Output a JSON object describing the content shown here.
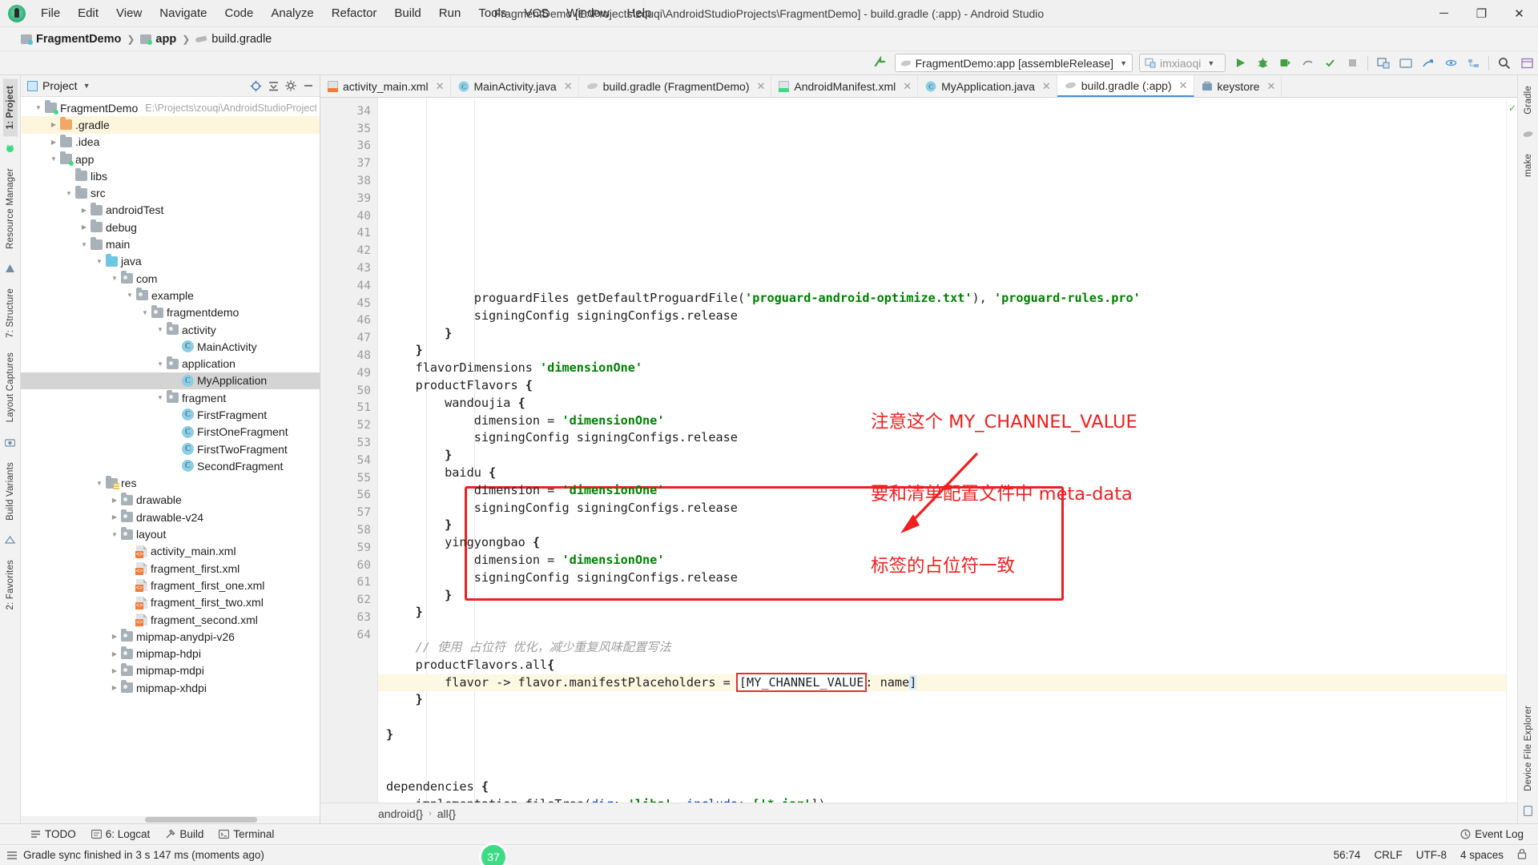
{
  "window": {
    "title": "FragmentDemo [E:\\Projects\\zouqi\\AndroidStudioProjects\\FragmentDemo] - build.gradle (:app) - Android Studio",
    "minimize": "─",
    "maximize": "❐",
    "close": "✕"
  },
  "menu": [
    {
      "label": "File"
    },
    {
      "label": "Edit"
    },
    {
      "label": "View"
    },
    {
      "label": "Navigate"
    },
    {
      "label": "Code"
    },
    {
      "label": "Analyze"
    },
    {
      "label": "Refactor"
    },
    {
      "label": "Build"
    },
    {
      "label": "Run"
    },
    {
      "label": "Tools"
    },
    {
      "label": "VCS"
    },
    {
      "label": "Window"
    },
    {
      "label": "Help"
    }
  ],
  "breadcrumb": {
    "project": "FragmentDemo",
    "module": "app",
    "file": "build.gradle"
  },
  "toolbar": {
    "run_config": "FragmentDemo:app [assembleRelease]",
    "device": "imxiaoqi",
    "search_icon": "search-icon",
    "caret": "▼"
  },
  "left_strip": [
    {
      "label": "1: Project"
    },
    {
      "label": "Resource Manager"
    },
    {
      "label": "7: Structure"
    },
    {
      "label": "Layout Captures"
    },
    {
      "label": "Build Variants"
    },
    {
      "label": "2: Favorites"
    }
  ],
  "right_strip": [
    {
      "label": "Gradle"
    },
    {
      "label": "make"
    },
    {
      "label": "Device File Explorer"
    },
    {
      "label": "Event Log"
    }
  ],
  "project_panel": {
    "title": "Project",
    "caret": "▼",
    "tree": [
      {
        "depth": 0,
        "arrow": "down",
        "icon": "folder-module",
        "label": "FragmentDemo",
        "path": "E:\\Projects\\zouqi\\AndroidStudioProject",
        "state": "normal"
      },
      {
        "depth": 1,
        "arrow": "right",
        "icon": "folder-orange",
        "label": ".gradle",
        "path": "",
        "state": "highlight"
      },
      {
        "depth": 1,
        "arrow": "right",
        "icon": "folder",
        "label": ".idea",
        "path": "",
        "state": "normal"
      },
      {
        "depth": 1,
        "arrow": "down",
        "icon": "folder-greendot",
        "label": "app",
        "path": "",
        "state": "normal"
      },
      {
        "depth": 2,
        "arrow": "none",
        "icon": "folder",
        "label": "libs",
        "path": "",
        "state": "normal"
      },
      {
        "depth": 2,
        "arrow": "down",
        "icon": "folder",
        "label": "src",
        "path": "",
        "state": "normal"
      },
      {
        "depth": 3,
        "arrow": "right",
        "icon": "folder",
        "label": "androidTest",
        "path": "",
        "state": "normal"
      },
      {
        "depth": 3,
        "arrow": "right",
        "icon": "folder",
        "label": "debug",
        "path": "",
        "state": "normal"
      },
      {
        "depth": 3,
        "arrow": "down",
        "icon": "folder",
        "label": "main",
        "path": "",
        "state": "normal"
      },
      {
        "depth": 4,
        "arrow": "down",
        "icon": "folder-cyan",
        "label": "java",
        "path": "",
        "state": "normal"
      },
      {
        "depth": 5,
        "arrow": "down",
        "icon": "folder-package",
        "label": "com",
        "path": "",
        "state": "normal"
      },
      {
        "depth": 6,
        "arrow": "down",
        "icon": "folder-package",
        "label": "example",
        "path": "",
        "state": "normal"
      },
      {
        "depth": 7,
        "arrow": "down",
        "icon": "folder-package",
        "label": "fragmentdemo",
        "path": "",
        "state": "normal"
      },
      {
        "depth": 8,
        "arrow": "down",
        "icon": "folder-package",
        "label": "activity",
        "path": "",
        "state": "normal"
      },
      {
        "depth": 9,
        "arrow": "none",
        "icon": "class",
        "label": "MainActivity",
        "path": "",
        "state": "normal"
      },
      {
        "depth": 8,
        "arrow": "down",
        "icon": "folder-package",
        "label": "application",
        "path": "",
        "state": "normal"
      },
      {
        "depth": 9,
        "arrow": "none",
        "icon": "class",
        "label": "MyApplication",
        "path": "",
        "state": "selected"
      },
      {
        "depth": 8,
        "arrow": "down",
        "icon": "folder-package",
        "label": "fragment",
        "path": "",
        "state": "normal"
      },
      {
        "depth": 9,
        "arrow": "none",
        "icon": "class",
        "label": "FirstFragment",
        "path": "",
        "state": "normal"
      },
      {
        "depth": 9,
        "arrow": "none",
        "icon": "class",
        "label": "FirstOneFragment",
        "path": "",
        "state": "normal"
      },
      {
        "depth": 9,
        "arrow": "none",
        "icon": "class",
        "label": "FirstTwoFragment",
        "path": "",
        "state": "normal"
      },
      {
        "depth": 9,
        "arrow": "none",
        "icon": "class",
        "label": "SecondFragment",
        "path": "",
        "state": "normal"
      },
      {
        "depth": 4,
        "arrow": "down",
        "icon": "folder-res",
        "label": "res",
        "path": "",
        "state": "normal"
      },
      {
        "depth": 5,
        "arrow": "right",
        "icon": "folder-package",
        "label": "drawable",
        "path": "",
        "state": "normal"
      },
      {
        "depth": 5,
        "arrow": "right",
        "icon": "folder-package",
        "label": "drawable-v24",
        "path": "",
        "state": "normal"
      },
      {
        "depth": 5,
        "arrow": "down",
        "icon": "folder-package",
        "label": "layout",
        "path": "",
        "state": "normal"
      },
      {
        "depth": 6,
        "arrow": "none",
        "icon": "xml",
        "label": "activity_main.xml",
        "path": "",
        "state": "normal"
      },
      {
        "depth": 6,
        "arrow": "none",
        "icon": "xml",
        "label": "fragment_first.xml",
        "path": "",
        "state": "normal"
      },
      {
        "depth": 6,
        "arrow": "none",
        "icon": "xml",
        "label": "fragment_first_one.xml",
        "path": "",
        "state": "normal"
      },
      {
        "depth": 6,
        "arrow": "none",
        "icon": "xml",
        "label": "fragment_first_two.xml",
        "path": "",
        "state": "normal"
      },
      {
        "depth": 6,
        "arrow": "none",
        "icon": "xml",
        "label": "fragment_second.xml",
        "path": "",
        "state": "normal"
      },
      {
        "depth": 5,
        "arrow": "right",
        "icon": "folder-package",
        "label": "mipmap-anydpi-v26",
        "path": "",
        "state": "normal"
      },
      {
        "depth": 5,
        "arrow": "right",
        "icon": "folder-package",
        "label": "mipmap-hdpi",
        "path": "",
        "state": "normal"
      },
      {
        "depth": 5,
        "arrow": "right",
        "icon": "folder-package",
        "label": "mipmap-mdpi",
        "path": "",
        "state": "normal"
      },
      {
        "depth": 5,
        "arrow": "right",
        "icon": "folder-package",
        "label": "mipmap-xhdpi",
        "path": "",
        "state": "normal"
      }
    ]
  },
  "editor_tabs": [
    {
      "label": "activity_main.xml",
      "icon": "xml-file-icon",
      "active": false
    },
    {
      "label": "MainActivity.java",
      "icon": "class-icon",
      "active": false
    },
    {
      "label": "build.gradle (FragmentDemo)",
      "icon": "gradle-icon",
      "active": false
    },
    {
      "label": "AndroidManifest.xml",
      "icon": "manifest-icon",
      "active": false
    },
    {
      "label": "MyApplication.java",
      "icon": "class-icon",
      "active": false
    },
    {
      "label": "build.gradle (:app)",
      "icon": "gradle-icon",
      "active": true
    },
    {
      "label": "keystore",
      "icon": "keystore-icon",
      "active": false
    }
  ],
  "code": {
    "first_line": 34,
    "current_line": 56,
    "lines": [
      {
        "n": 34,
        "html": "            proguardFiles getDefaultProguardFile(<s>'proguard-android-optimize.txt'</s>), <s>'proguard-rules.pro'</s>"
      },
      {
        "n": 35,
        "html": "            signingConfig signingConfigs.release"
      },
      {
        "n": 36,
        "html": "        <b>}</b>",
        "fold": "minus"
      },
      {
        "n": 37,
        "html": "    <b>}</b>",
        "fold": "minus"
      },
      {
        "n": 38,
        "html": "    flavorDimensions <s>'dimensionOne'</s>"
      },
      {
        "n": 39,
        "html": "    productFlavors <b>{</b>",
        "fold": "plus-light"
      },
      {
        "n": 40,
        "html": "        wandoujia <b>{</b>",
        "fold": "plus-light"
      },
      {
        "n": 41,
        "html": "            dimension = <s>'dimensionOne'</s>"
      },
      {
        "n": 42,
        "html": "            signingConfig signingConfigs.release"
      },
      {
        "n": 43,
        "html": "        <b>}</b>",
        "fold": "minus"
      },
      {
        "n": 44,
        "html": "        baidu <b>{</b>"
      },
      {
        "n": 45,
        "html": "            dimension = <s>'dimensionOne'</s>"
      },
      {
        "n": 46,
        "html": "            signingConfig signingConfigs.release"
      },
      {
        "n": 47,
        "html": "        <b>}</b>",
        "fold": "minus"
      },
      {
        "n": 48,
        "html": "        yingyongbao <b>{</b>",
        "fold": "minus"
      },
      {
        "n": 49,
        "html": "            dimension = <s>'dimensionOne'</s>"
      },
      {
        "n": 50,
        "html": "            signingConfig signingConfigs.release"
      },
      {
        "n": 51,
        "html": "        <b>}</b>",
        "fold": "minus"
      },
      {
        "n": 52,
        "html": "    <b>}</b>",
        "fold": "minus"
      },
      {
        "n": 53,
        "html": ""
      },
      {
        "n": 54,
        "html": "    <c>// 使用 占位符 优化，减少重复风味配置写法</c>"
      },
      {
        "n": 55,
        "html": "    productFlavors.all<b>{</b>"
      },
      {
        "n": 56,
        "html": "        flavor -&gt; flavor.manifestPlaceholders = <hl>[MY_CHANNEL_VALUE</hl>: name<brk>]</brk>",
        "current": true,
        "bulb": true
      },
      {
        "n": 57,
        "html": "    <b>}</b>"
      },
      {
        "n": 58,
        "html": ""
      },
      {
        "n": 59,
        "html": "<b>}</b>",
        "fold": "minus"
      },
      {
        "n": 60,
        "html": ""
      },
      {
        "n": 61,
        "html": ""
      },
      {
        "n": 62,
        "html": "dependencies <b>{</b>",
        "run": true
      },
      {
        "n": 63,
        "html": "    implementation fileTree(<k>dir</k>: <s>'libs'</s>, <k>include</k>: <s>['*.jar'</s>])"
      },
      {
        "n": 64,
        "html": ""
      }
    ]
  },
  "annotation": {
    "line1": "注意这个 MY_CHANNEL_VALUE",
    "line2": "要和清单配置文件中 meta-data",
    "line3": "标签的占位符一致",
    "color": "#ef2020"
  },
  "editor_breadcrumb": {
    "item1": "android{}",
    "item2": "all{}",
    "sep": "›"
  },
  "bottom_tools": [
    {
      "label": "TODO",
      "icon": "checklist-icon"
    },
    {
      "label": "6: Logcat",
      "icon": "logcat-icon"
    },
    {
      "label": "Build",
      "icon": "hammer-icon"
    },
    {
      "label": "Terminal",
      "icon": "terminal-icon"
    }
  ],
  "status_bar": {
    "message": "Gradle sync finished in 3 s 147 ms (moments ago)",
    "sync_badge": "37",
    "caret_position": "56:74",
    "line_separator": "CRLF",
    "encoding": "UTF-8",
    "indent": "4 spaces",
    "event_log": "Event Log",
    "lock_icon": "lock-icon"
  }
}
